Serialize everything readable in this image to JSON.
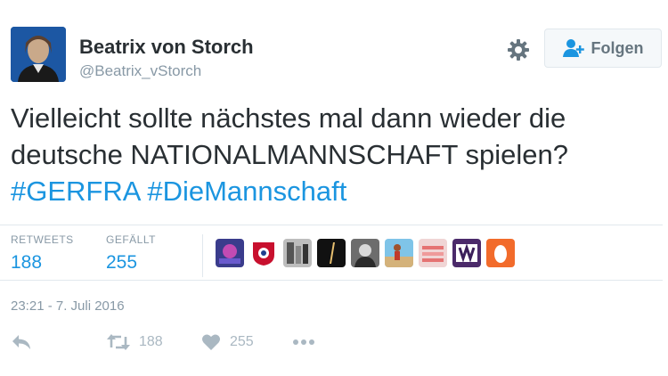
{
  "user": {
    "display_name": "Beatrix von Storch",
    "username": "@Beatrix_vStorch"
  },
  "follow_button": {
    "label": "Folgen"
  },
  "tweet": {
    "text_line1": "Vielleicht sollte nächstes mal dann wieder die",
    "text_line2": "deutsche NATIONALMANNSCHAFT spielen?",
    "hashtags": [
      "#GERFRA",
      "#DieMannschaft"
    ]
  },
  "stats": {
    "retweets_label": "RETWEETS",
    "retweets_value": "188",
    "likes_label": "GEFÄLLT",
    "likes_value": "255"
  },
  "timestamp": "23:21 - 7. Juli 2016",
  "actions": {
    "retweet_count": "188",
    "like_count": "255"
  },
  "colors": {
    "link": "#1b95e0",
    "text": "#292f33",
    "muted": "#8899a6",
    "border": "#e1e8ed"
  },
  "icons": [
    "gear-icon",
    "follow-person-icon",
    "reply-icon",
    "retweet-icon",
    "heart-icon",
    "more-icon"
  ]
}
